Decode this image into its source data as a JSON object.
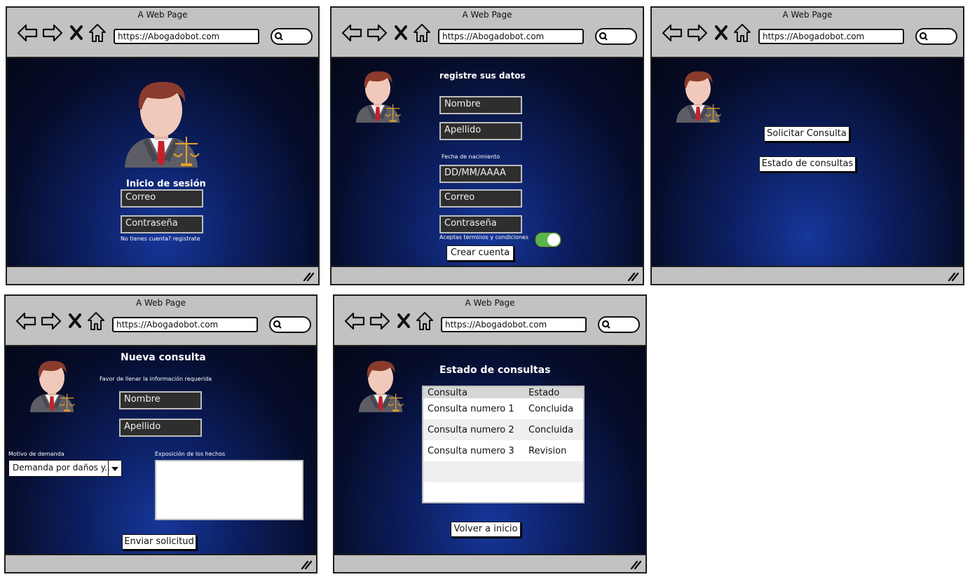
{
  "browser": {
    "page_title": "A Web Page",
    "url": "https://Abogadobot.com"
  },
  "screen1": {
    "heading": "Inicio de sesión",
    "email_field": "Correo",
    "password_field": "Contraseña",
    "register_link": "No tienes cuenta? registrate"
  },
  "screen2": {
    "heading": "registre sus datos",
    "first_name_field": "Nombre",
    "last_name_field": "Apellido",
    "birthdate_label": "Fecha de nacimiento",
    "birthdate_field": "DD/MM/AAAA",
    "email_field": "Correo",
    "password_field": "Contraseña",
    "terms_label": "Aceptas terminos y condiciones",
    "terms_toggle_on": true,
    "create_button": "Crear cuenta"
  },
  "screen3": {
    "request_button": "Solicitar Consulta",
    "status_button": "Estado de consultas"
  },
  "screen4": {
    "heading": "Nueva consulta",
    "subheading": "Favor de llenar la información requerida",
    "first_name_field": "Nombre",
    "last_name_field": "Apellido",
    "reason_label": "Motivo de demanda",
    "reason_value": "Demanda por daños y..",
    "facts_label": "Exposición de los hechos",
    "facts_value": "",
    "submit_button": "Enviar solicitud"
  },
  "screen5": {
    "heading": "Estado de consultas",
    "table": {
      "columns": [
        "Consulta",
        "Estado"
      ],
      "rows": [
        [
          "Consulta numero 1",
          "Concluida"
        ],
        [
          "Consulta numero 2",
          "Concluida"
        ],
        [
          "Consulta numero 3",
          "Revision"
        ],
        [
          "",
          ""
        ],
        [
          "",
          ""
        ]
      ]
    },
    "back_button": "Volver a inicio"
  },
  "icons": {
    "back": "back-arrow-icon",
    "forward": "forward-arrow-icon",
    "stop": "close-icon",
    "home": "home-icon",
    "search": "search-icon",
    "resize": "resize-grip-icon",
    "avatar": "lawyer-avatar-icon"
  },
  "colors": {
    "background_top": "#060d2c",
    "background_glow": "#16379a",
    "toggle_on": "#59b44a"
  }
}
